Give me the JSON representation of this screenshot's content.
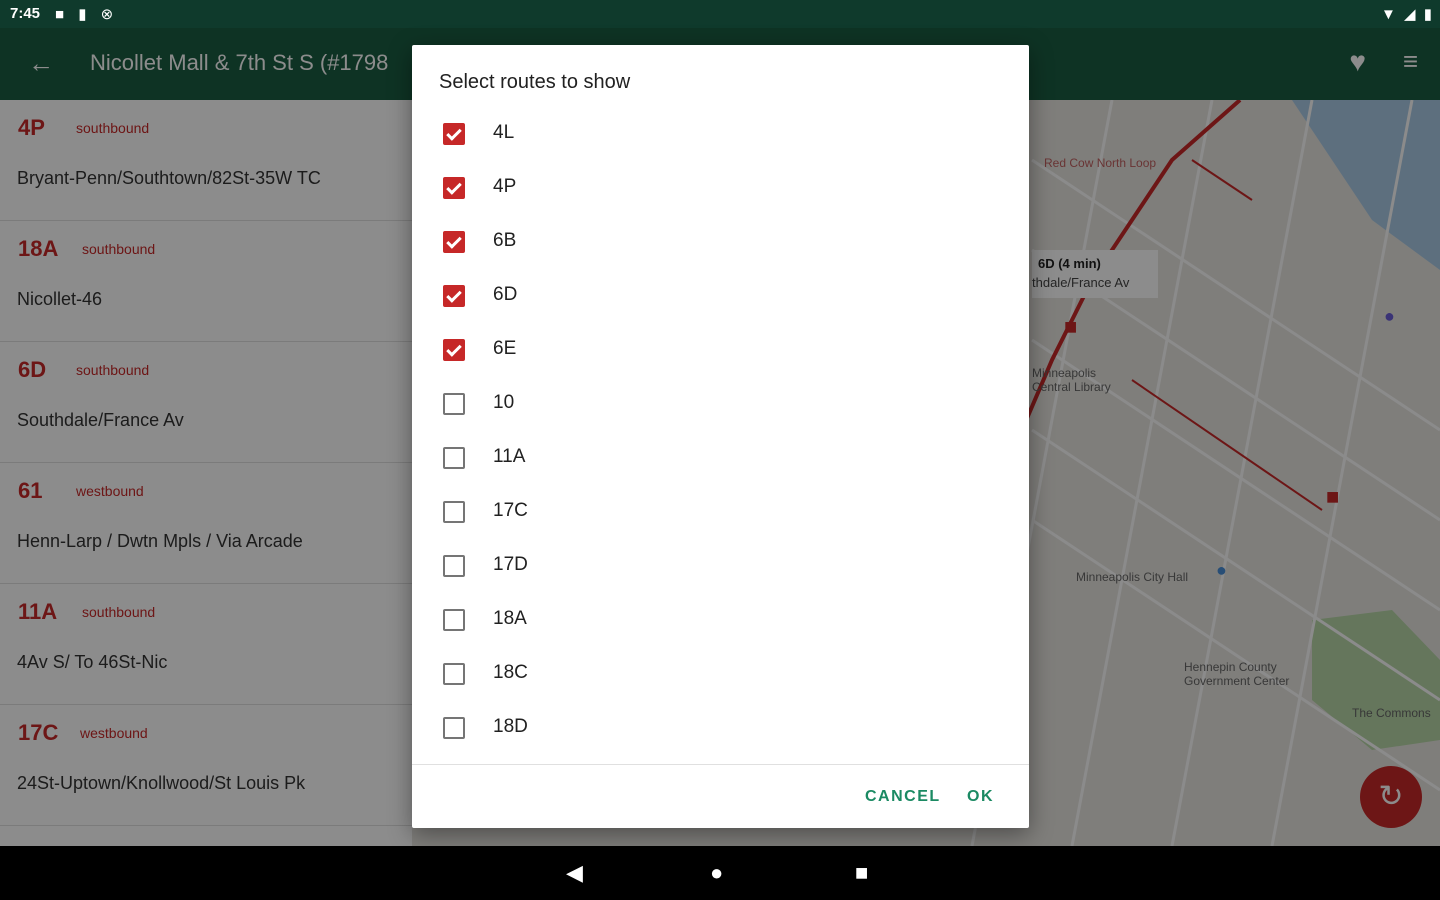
{
  "status": {
    "time": "7:45"
  },
  "appbar": {
    "title": "Nicollet Mall & 7th St S (#1798"
  },
  "list": [
    {
      "route": "4P",
      "direction": "southbound",
      "destination": "Bryant-Penn/Southtown/82St-35W TC"
    },
    {
      "route": "18A",
      "direction": "southbound",
      "destination": "Nicollet-46"
    },
    {
      "route": "6D",
      "direction": "southbound",
      "destination": "Southdale/France Av"
    },
    {
      "route": "61",
      "direction": "westbound",
      "destination": "Henn-Larp / Dwtn Mpls / Via  Arcade"
    },
    {
      "route": "11A",
      "direction": "southbound",
      "destination": "4Av S/ To 46St-Nic"
    },
    {
      "route": "17C",
      "direction": "westbound",
      "destination": "24St-Uptown/Knollwood/St Louis Pk"
    }
  ],
  "map": {
    "labels": {
      "red_cow": "Red Cow North Loop",
      "bus_time": "6D (4 min)",
      "bus_dest": "thdale/France Av",
      "library": "Minneapolis Central Library",
      "city_hall": "Minneapolis City Hall",
      "hennepin": "Hennepin County Government Center",
      "commons": "The Commons"
    }
  },
  "dialog": {
    "title": "Select routes to show",
    "options": [
      {
        "label": "4L",
        "checked": true
      },
      {
        "label": "4P",
        "checked": true
      },
      {
        "label": "6B",
        "checked": true
      },
      {
        "label": "6D",
        "checked": true
      },
      {
        "label": "6E",
        "checked": true
      },
      {
        "label": "10",
        "checked": false
      },
      {
        "label": "11A",
        "checked": false
      },
      {
        "label": "17C",
        "checked": false
      },
      {
        "label": "17D",
        "checked": false
      },
      {
        "label": "18A",
        "checked": false
      },
      {
        "label": "18C",
        "checked": false
      },
      {
        "label": "18D",
        "checked": false
      }
    ],
    "cancel_label": "CANCEL",
    "ok_label": "OK"
  },
  "colors": {
    "primary": "#1b5e43",
    "accent": "#c62828",
    "button_text": "#1b8a63"
  }
}
